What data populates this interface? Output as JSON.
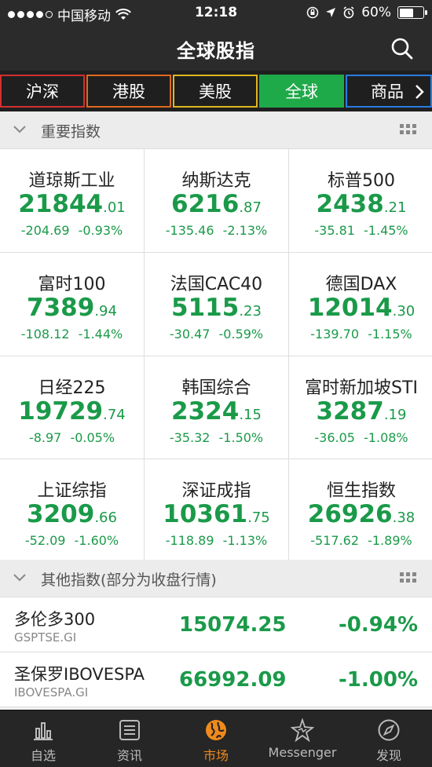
{
  "status_bar": {
    "carrier": "中国移动",
    "time": "12:18",
    "battery": "60%",
    "battery_level": 0.6
  },
  "nav": {
    "title": "全球股指"
  },
  "tabs": [
    {
      "label": "沪深"
    },
    {
      "label": "港股"
    },
    {
      "label": "美股"
    },
    {
      "label": "全球"
    },
    {
      "label": "商品"
    }
  ],
  "sections": {
    "important": "重要指数",
    "other": "其他指数(部分为收盘行情)"
  },
  "indices": [
    {
      "name": "道琼斯工业",
      "int": "21844",
      "dec": ".01",
      "change": "-204.69",
      "pct": "-0.93%"
    },
    {
      "name": "纳斯达克",
      "int": "6216",
      "dec": ".87",
      "change": "-135.46",
      "pct": "-2.13%"
    },
    {
      "name": "标普500",
      "int": "2438",
      "dec": ".21",
      "change": "-35.81",
      "pct": "-1.45%"
    },
    {
      "name": "富时100",
      "int": "7389",
      "dec": ".94",
      "change": "-108.12",
      "pct": "-1.44%"
    },
    {
      "name": "法国CAC40",
      "int": "5115",
      "dec": ".23",
      "change": "-30.47",
      "pct": "-0.59%"
    },
    {
      "name": "德国DAX",
      "int": "12014",
      "dec": ".30",
      "change": "-139.70",
      "pct": "-1.15%"
    },
    {
      "name": "日经225",
      "int": "19729",
      "dec": ".74",
      "change": "-8.97",
      "pct": "-0.05%"
    },
    {
      "name": "韩国综合",
      "int": "2324",
      "dec": ".15",
      "change": "-35.32",
      "pct": "-1.50%"
    },
    {
      "name": "富时新加坡STI",
      "int": "3287",
      "dec": ".19",
      "change": "-36.05",
      "pct": "-1.08%"
    },
    {
      "name": "上证综指",
      "int": "3209",
      "dec": ".66",
      "change": "-52.09",
      "pct": "-1.60%"
    },
    {
      "name": "深证成指",
      "int": "10361",
      "dec": ".75",
      "change": "-118.89",
      "pct": "-1.13%"
    },
    {
      "name": "恒生指数",
      "int": "26926",
      "dec": ".38",
      "change": "-517.62",
      "pct": "-1.89%"
    }
  ],
  "others": [
    {
      "name": "多伦多300",
      "code": "GSPTSE.GI",
      "value": "15074.25",
      "pct": "-0.94%"
    },
    {
      "name": "圣保罗IBOVESPA",
      "code": "IBOVESPA.GI",
      "value": "66992.09",
      "pct": "-1.00%"
    }
  ],
  "tabbar": [
    {
      "label": "自选",
      "icon": "bar-chart-icon"
    },
    {
      "label": "资讯",
      "icon": "news-icon"
    },
    {
      "label": "市场",
      "icon": "globe-icon"
    },
    {
      "label": "Messenger",
      "icon": "messenger-icon"
    },
    {
      "label": "发现",
      "icon": "compass-icon"
    }
  ],
  "colors": {
    "up_down_green": "#1a9a49",
    "active_tab": "#f08a1c",
    "header_bg": "#2b2b2b"
  }
}
